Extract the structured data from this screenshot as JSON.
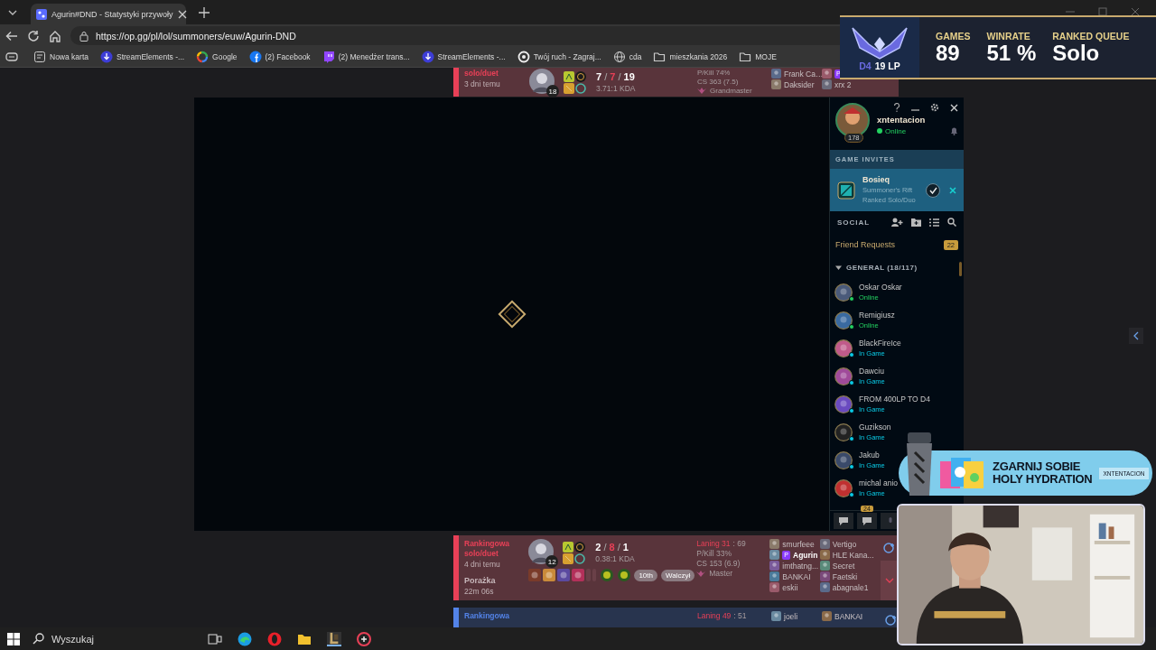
{
  "browser": {
    "tab_title": "Agurin#DND - Statystyki przywoły",
    "url": "https://op.gg/pl/lol/summoners/euw/Agurin-DND",
    "bookmarks": [
      {
        "label": "Nowa karta",
        "kind": "page"
      },
      {
        "label": "StreamElements -...",
        "kind": "se"
      },
      {
        "label": "Google",
        "kind": "google"
      },
      {
        "label": "(2) Facebook",
        "kind": "facebook"
      },
      {
        "label": "(2) Menedżer trans...",
        "kind": "twitch"
      },
      {
        "label": "StreamElements -...",
        "kind": "se"
      },
      {
        "label": "Twój ruch - Zagraj...",
        "kind": "ring"
      },
      {
        "label": "cda",
        "kind": "globe"
      },
      {
        "label": "mieszkania 2026",
        "kind": "folder"
      },
      {
        "label": "MOJE",
        "kind": "folder"
      }
    ]
  },
  "matches": [
    {
      "kind": "loss",
      "queue": "solo/duet",
      "when": "3 dni temu",
      "champion_level": "18",
      "score": [
        "7",
        "7",
        "19"
      ],
      "separator": "/",
      "kda": "3.71:1 KDA",
      "stats": [
        "P/Kill 74%",
        "CS 363 (7.5)"
      ],
      "rank": "Grandmaster",
      "team1": [
        {
          "name": "Frank Ca…"
        },
        {
          "name": "Daksider"
        }
      ],
      "team2": [
        {
          "badge": "P"
        },
        {
          "name": "xrx 2"
        }
      ]
    },
    {
      "kind": "loss",
      "queue": "Rankingowa solo/duet",
      "when": "4 dni temu",
      "result_label": "Porażka",
      "duration": "22m 06s",
      "champion_level": "12",
      "score": [
        "2",
        "8",
        "1"
      ],
      "separator": "/",
      "kda": "0.38:1 KDA",
      "laning": "Laning 31",
      "laning_rest": ": 69",
      "stats": [
        "P/Kill 33%",
        "CS 153 (6.9)"
      ],
      "rank": "Master",
      "items": [
        {
          "kind": "item"
        },
        {
          "kind": "item"
        },
        {
          "kind": "item"
        },
        {
          "kind": "item"
        },
        {
          "kind": "empty"
        },
        {
          "kind": "empty"
        },
        {
          "kind": "ward"
        },
        {
          "kind": "ward"
        }
      ],
      "badges": [
        "10th",
        "Walczył"
      ],
      "team1": [
        {
          "name": "smurfeee"
        },
        {
          "name": "Agurin",
          "badge": "P",
          "selected": true
        },
        {
          "name": "imthatng..."
        },
        {
          "name": "BANKAI"
        },
        {
          "name": "eskii"
        }
      ],
      "team2": [
        {
          "name": "Vertigo"
        },
        {
          "name": "HLE Kana..."
        },
        {
          "name": "Secret"
        },
        {
          "name": "Faetski"
        },
        {
          "name": "abagnale1"
        }
      ]
    },
    {
      "kind": "win",
      "queue": "Rankingowa",
      "laning": "Laning 49",
      "laning_rest": ": 51",
      "team1": [
        {
          "name": "joeli"
        }
      ],
      "team2": [
        {
          "name": "BANKAI"
        }
      ]
    }
  ],
  "rank_overlay": {
    "tier": "D4",
    "lp": "19 LP",
    "stats": [
      {
        "label": "GAMES",
        "value": "89"
      },
      {
        "label": "WINRATE",
        "value": "51 %"
      },
      {
        "label": "RANKED QUEUE",
        "value": "Solo"
      }
    ]
  },
  "client": {
    "profile": {
      "name": "xntentacion",
      "status": "Online",
      "level": "178"
    },
    "invites_title": "GAME INVITES",
    "invite": {
      "name": "Bosieq",
      "map": "Summoner's Rift",
      "queue": "Ranked Solo/Duo"
    },
    "social_title": "SOCIAL",
    "friend_requests": {
      "label": "Friend Requests",
      "count": "22"
    },
    "group": {
      "label": "GENERAL (18/117)",
      "expanded": true,
      "friends": [
        {
          "name": "Oskar Oskar",
          "kind": "online",
          "status_text": "Online"
        },
        {
          "name": "Remigiusz",
          "kind": "online",
          "status_text": "Online"
        },
        {
          "name": "BlackFireIce",
          "kind": "ingame",
          "status_text": "In Game"
        },
        {
          "name": "Dawciu",
          "kind": "ingame",
          "status_text": "In Game"
        },
        {
          "name": "FROM 400LP TO D4",
          "kind": "ingame",
          "status_text": "In Game"
        },
        {
          "name": "Guzikson",
          "kind": "ingame",
          "status_text": "In Game"
        },
        {
          "name": "Jakub",
          "kind": "ingame",
          "status_text": "In Game"
        },
        {
          "name": "michal anio",
          "kind": "ingame",
          "status_text": "In Game"
        }
      ]
    },
    "chat_badge": "24"
  },
  "ad": {
    "headline": [
      "ZGARNIJ SOBIE",
      "HOLY HYDRATION"
    ],
    "code": "XNTENTACION"
  },
  "taskbar": {
    "search": "Wyszukaj"
  }
}
